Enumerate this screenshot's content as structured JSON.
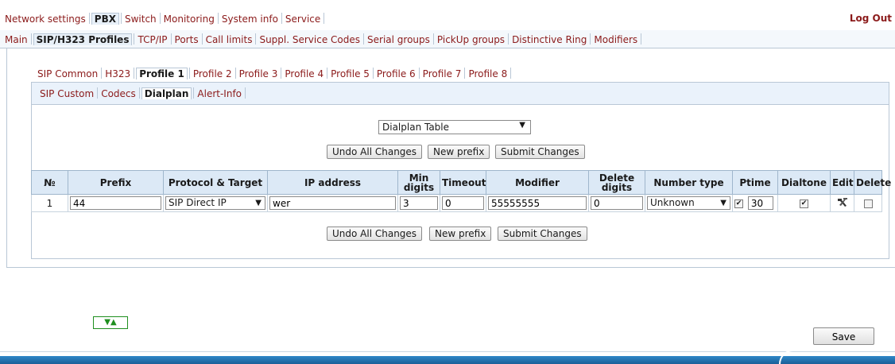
{
  "top_menu": {
    "tabs": [
      {
        "label": "Network settings",
        "active": false
      },
      {
        "label": "PBX",
        "active": true
      },
      {
        "label": "Switch",
        "active": false
      },
      {
        "label": "Monitoring",
        "active": false
      },
      {
        "label": "System info",
        "active": false
      },
      {
        "label": "Service",
        "active": false
      }
    ],
    "logout": "Log Out"
  },
  "sub_menu": {
    "tabs": [
      {
        "label": "Main",
        "active": false
      },
      {
        "label": "SIP/H323 Profiles",
        "active": true
      },
      {
        "label": "TCP/IP",
        "active": false
      },
      {
        "label": "Ports",
        "active": false
      },
      {
        "label": "Call limits",
        "active": false
      },
      {
        "label": "Suppl. Service Codes",
        "active": false
      },
      {
        "label": "Serial groups",
        "active": false
      },
      {
        "label": "PickUp groups",
        "active": false
      },
      {
        "label": "Distinctive Ring",
        "active": false
      },
      {
        "label": "Modifiers",
        "active": false
      }
    ]
  },
  "profile_tabs": [
    {
      "label": "SIP Common",
      "active": false
    },
    {
      "label": "H323",
      "active": false
    },
    {
      "label": "Profile 1",
      "active": true
    },
    {
      "label": "Profile 2",
      "active": false
    },
    {
      "label": "Profile 3",
      "active": false
    },
    {
      "label": "Profile 4",
      "active": false
    },
    {
      "label": "Profile 5",
      "active": false
    },
    {
      "label": "Profile 6",
      "active": false
    },
    {
      "label": "Profile 7",
      "active": false
    },
    {
      "label": "Profile 8",
      "active": false
    }
  ],
  "panel_tabs": [
    {
      "label": "SIP Custom",
      "active": false
    },
    {
      "label": "Codecs",
      "active": false
    },
    {
      "label": "Dialplan",
      "active": true
    },
    {
      "label": "Alert-Info",
      "active": false
    }
  ],
  "dialplan_select": {
    "value": "Dialplan Table"
  },
  "buttons": {
    "undo": "Undo All Changes",
    "new_prefix": "New prefix",
    "submit": "Submit Changes",
    "save": "Save"
  },
  "table": {
    "headers": {
      "num": "№",
      "prefix": "Prefix",
      "protocol": "Protocol & Target",
      "ip": "IP address",
      "min_digits": "Min digits",
      "timeout": "Timeout",
      "modifier": "Modifier",
      "delete_digits": "Delete digits",
      "number_type": "Number type",
      "ptime": "Ptime",
      "dialtone": "Dialtone",
      "edit": "Edit",
      "delete": "Delete"
    },
    "rows": [
      {
        "num": "1",
        "prefix": "44",
        "protocol": "SIP Direct IP",
        "ip": "wer",
        "min_digits": "3",
        "timeout": "0",
        "modifier": "55555555",
        "delete_digits": "0",
        "number_type": "Unknown",
        "ptime_enabled": true,
        "ptime": "30",
        "dialtone": true,
        "delete": false
      }
    ]
  },
  "icons": {
    "collapse": "arrows-up-down-icon",
    "edit": "hammer-wrench-icon"
  },
  "colors": {
    "link": "#8b1a1a",
    "header_bg": "#dce9f6",
    "border": "#b9c7d6",
    "footer": "#2e87c8",
    "mini_button": "#1f8f1f"
  }
}
